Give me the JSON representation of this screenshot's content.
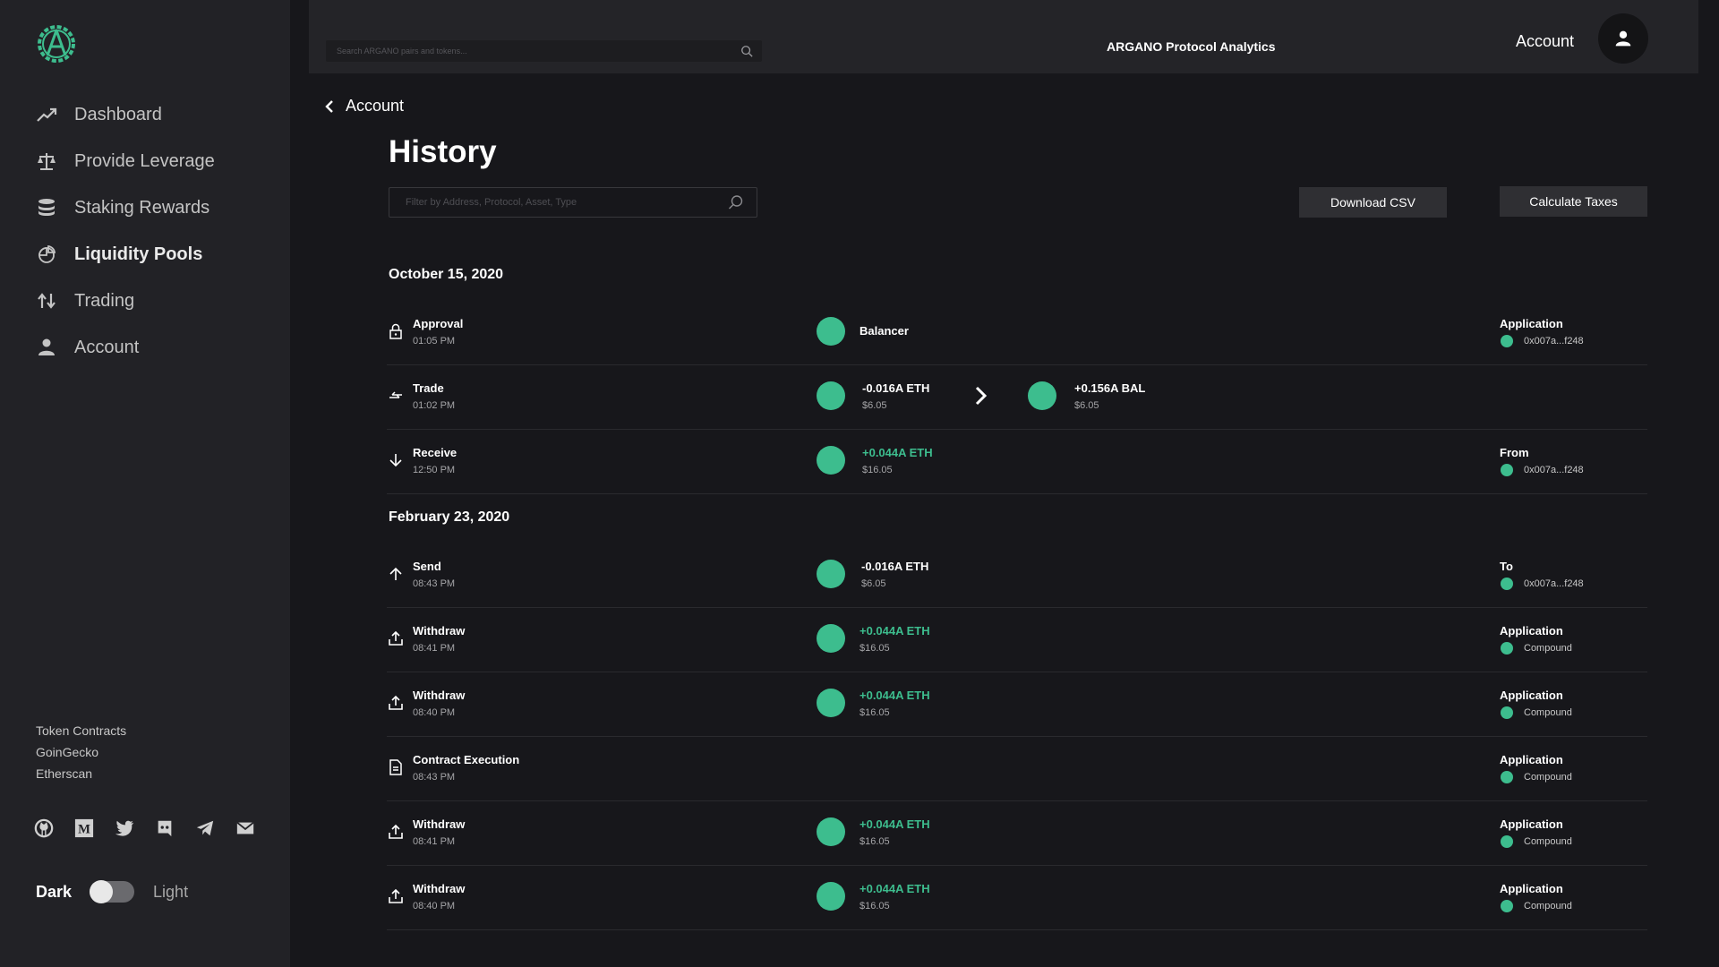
{
  "sidebar": {
    "nav": [
      {
        "label": "Dashboard",
        "icon": "trending-up-icon"
      },
      {
        "label": "Provide Leverage",
        "icon": "scale-icon"
      },
      {
        "label": "Staking Rewards",
        "icon": "coins-stack-icon"
      },
      {
        "label": "Liquidity Pools",
        "icon": "pie-chart-icon"
      },
      {
        "label": "Trading",
        "icon": "swap-vertical-icon"
      },
      {
        "label": "Account",
        "icon": "user-icon"
      }
    ],
    "links": [
      "Token Contracts",
      "GoinGecko",
      "Etherscan"
    ],
    "theme": {
      "dark": "Dark",
      "light": "Light"
    }
  },
  "header": {
    "search_placeholder": "Search ARGANO pairs and tokens...",
    "title": "ARGANO Protocol Analytics",
    "account": "Account"
  },
  "main": {
    "back_label": "Account",
    "title": "History",
    "filter_placeholder": "Filter by Address, Protocol, Asset, Type",
    "download_csv": "Download CSV",
    "calculate_taxes": "Calculate Taxes",
    "groups": [
      {
        "date": "October 15, 2020"
      },
      {
        "date": "February 23, 2020"
      }
    ],
    "rows": [
      {
        "type": "Approval",
        "time": "01:05 PM",
        "protocol": "Balancer",
        "meta_label": "Application",
        "meta_value": "0x007a...f248"
      },
      {
        "type": "Trade",
        "time": "01:02 PM",
        "from_amount": "-0.016A ETH",
        "from_usd": "$6.05",
        "to_amount": "+0.156A BAL",
        "to_usd": "$6.05"
      },
      {
        "type": "Receive",
        "time": "12:50 PM",
        "amount": "+0.044A ETH",
        "usd": "$16.05",
        "meta_label": "From",
        "meta_value": "0x007a...f248"
      },
      {
        "type": "Send",
        "time": "08:43 PM",
        "amount": "-0.016A ETH",
        "usd": "$6.05",
        "meta_label": "To",
        "meta_value": "0x007a...f248"
      },
      {
        "type": "Withdraw",
        "time": "08:41 PM",
        "amount": "+0.044A ETH",
        "usd": "$16.05",
        "meta_label": "Application",
        "meta_value": "Compound"
      },
      {
        "type": "Withdraw",
        "time": "08:40 PM",
        "amount": "+0.044A ETH",
        "usd": "$16.05",
        "meta_label": "Application",
        "meta_value": "Compound"
      },
      {
        "type": "Contract Execution",
        "time": "08:43 PM",
        "meta_label": "Application",
        "meta_value": "Compound"
      },
      {
        "type": "Withdraw",
        "time": "08:41 PM",
        "amount": "+0.044A ETH",
        "usd": "$16.05",
        "meta_label": "Application",
        "meta_value": "Compound"
      },
      {
        "type": "Withdraw",
        "time": "08:40 PM",
        "amount": "+0.044A ETH",
        "usd": "$16.05",
        "meta_label": "Application",
        "meta_value": "Compound"
      }
    ]
  },
  "colors": {
    "accent": "#3dbd8e",
    "background": "#17171b",
    "sidebar": "#222226"
  }
}
